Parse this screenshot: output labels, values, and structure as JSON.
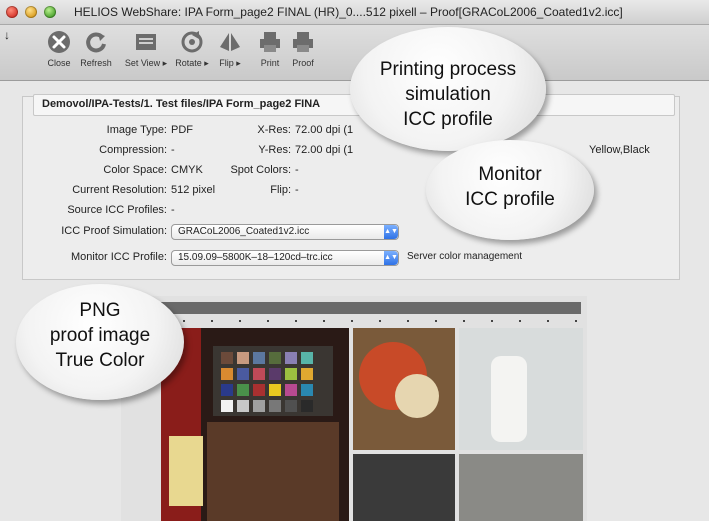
{
  "window": {
    "title": "HELIOS WebShare: IPA Form_page2 FINAL (HR)_0....512 pixell – Proof[GRACoL2006_Coated1v2.icc]"
  },
  "toolbar": {
    "pin": "↓",
    "items": [
      {
        "label": "Close",
        "icon": "close-icon"
      },
      {
        "label": "Refresh",
        "icon": "refresh-icon"
      },
      {
        "label": "Set View ▸",
        "icon": "set-view-icon"
      },
      {
        "label": "Rotate ▸",
        "icon": "rotate-icon"
      },
      {
        "label": "Flip ▸",
        "icon": "flip-icon"
      },
      {
        "label": "Print",
        "icon": "print-icon"
      },
      {
        "label": "Proof",
        "icon": "proof-icon"
      }
    ]
  },
  "info": {
    "path": "Demovol/IPA-Tests/1. Test files/IPA Form_page2 FINA",
    "image_type_label": "Image Type:",
    "image_type_value": "PDF",
    "compression_label": "Compression:",
    "compression_value": "-",
    "color_space_label": "Color Space:",
    "color_space_value": "CMYK",
    "current_resolution_label": "Current Resolution:",
    "current_resolution_value": "512 pixel",
    "source_icc_label": "Source ICC Profiles:",
    "source_icc_value": "-",
    "xres_label": "X-Res:",
    "xres_value": "72.00 dpi (1",
    "yres_label": "Y-Res:",
    "yres_value": "72.00 dpi (1",
    "spot_colors_label": "Spot Colors:",
    "spot_colors_value": "-",
    "flip_label": "Flip:",
    "flip_value": "-",
    "plates_value": "Yellow,Black",
    "icc_proof_label": "ICC Proof Simulation:",
    "icc_proof_value": "GRACoL2006_Coated1v2.icc",
    "monitor_icc_label": "Monitor ICC Profile:",
    "monitor_icc_value": "15.09.09–5800K–18–120cd–trc.icc",
    "server_color_mgmt": "Server color management"
  },
  "callouts": {
    "printing_line1": "Printing process",
    "printing_line2": "simulation",
    "printing_line3": "ICC profile",
    "monitor_line1": "Monitor",
    "monitor_line2": "ICC profile",
    "png_line1": "PNG",
    "png_line2": "proof image",
    "png_line3": "True Color"
  },
  "colors": {
    "accent_blue": "#2f72e6",
    "bubble_fill": "#f3f3f3"
  }
}
